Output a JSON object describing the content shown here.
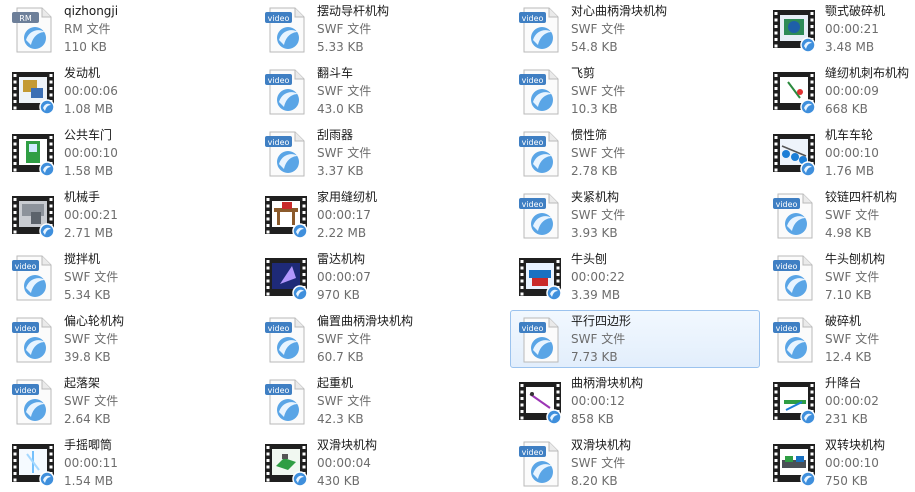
{
  "colors": {
    "selection_border": "#9cc3ee",
    "secondary_text": "#6d6d6d",
    "swf_badge": "#3f7fc3"
  },
  "files": [
    {
      "name": "qizhongji",
      "meta": "RM 文件",
      "size": "110 KB",
      "icon": "rm-file-icon",
      "badge": "RM"
    },
    {
      "name": "摆动导杆机构",
      "meta": "SWF 文件",
      "size": "5.33 KB",
      "icon": "swf-file-icon",
      "badge": "video"
    },
    {
      "name": "对心曲柄滑块机构",
      "meta": "SWF 文件",
      "size": "54.8 KB",
      "icon": "swf-file-icon",
      "badge": "video"
    },
    {
      "name": "颚式破碎机",
      "meta": "00:00:21",
      "size": "3.48 MB",
      "icon": "video-thumbnail-icon"
    },
    {
      "name": "发动机",
      "meta": "00:00:06",
      "size": "1.08 MB",
      "icon": "video-thumbnail-icon"
    },
    {
      "name": "翻斗车",
      "meta": "SWF 文件",
      "size": "43.0 KB",
      "icon": "swf-file-icon",
      "badge": "video"
    },
    {
      "name": "飞剪",
      "meta": "SWF 文件",
      "size": "10.3 KB",
      "icon": "swf-file-icon",
      "badge": "video"
    },
    {
      "name": "缝纫机刺布机构",
      "meta": "00:00:09",
      "size": "668 KB",
      "icon": "video-thumbnail-icon"
    },
    {
      "name": "公共车门",
      "meta": "00:00:10",
      "size": "1.58 MB",
      "icon": "video-thumbnail-icon"
    },
    {
      "name": "刮雨器",
      "meta": "SWF 文件",
      "size": "3.37 KB",
      "icon": "swf-file-icon",
      "badge": "video"
    },
    {
      "name": "惯性筛",
      "meta": "SWF 文件",
      "size": "2.78 KB",
      "icon": "swf-file-icon",
      "badge": "video"
    },
    {
      "name": "机车车轮",
      "meta": "00:00:10",
      "size": "1.76 MB",
      "icon": "video-thumbnail-icon"
    },
    {
      "name": "机械手",
      "meta": "00:00:21",
      "size": "2.71 MB",
      "icon": "video-thumbnail-icon"
    },
    {
      "name": "家用缝纫机",
      "meta": "00:00:17",
      "size": "2.22 MB",
      "icon": "video-thumbnail-icon"
    },
    {
      "name": "夹紧机构",
      "meta": "SWF 文件",
      "size": "3.93 KB",
      "icon": "swf-file-icon",
      "badge": "video"
    },
    {
      "name": "铰链四杆机构",
      "meta": "SWF 文件",
      "size": "4.98 KB",
      "icon": "swf-file-icon",
      "badge": "video"
    },
    {
      "name": "搅拌机",
      "meta": "SWF 文件",
      "size": "5.34 KB",
      "icon": "swf-file-icon",
      "badge": "video"
    },
    {
      "name": "雷达机构",
      "meta": "00:00:07",
      "size": "970 KB",
      "icon": "video-thumbnail-icon"
    },
    {
      "name": "牛头刨",
      "meta": "00:00:22",
      "size": "3.39 MB",
      "icon": "video-thumbnail-icon"
    },
    {
      "name": "牛头刨机构",
      "meta": "SWF 文件",
      "size": "7.10 KB",
      "icon": "swf-file-icon",
      "badge": "video"
    },
    {
      "name": "偏心轮机构",
      "meta": "SWF 文件",
      "size": "39.8 KB",
      "icon": "swf-file-icon",
      "badge": "video"
    },
    {
      "name": "偏置曲柄滑块机构",
      "meta": "SWF 文件",
      "size": "60.7 KB",
      "icon": "swf-file-icon",
      "badge": "video"
    },
    {
      "name": "平行四边形",
      "meta": "SWF 文件",
      "size": "7.73 KB",
      "icon": "swf-file-icon",
      "badge": "video",
      "selected": true
    },
    {
      "name": "破碎机",
      "meta": "SWF 文件",
      "size": "12.4 KB",
      "icon": "swf-file-icon",
      "badge": "video"
    },
    {
      "name": "起落架",
      "meta": "SWF 文件",
      "size": "2.64 KB",
      "icon": "swf-file-icon",
      "badge": "video"
    },
    {
      "name": "起重机",
      "meta": "SWF 文件",
      "size": "42.3 KB",
      "icon": "swf-file-icon",
      "badge": "video"
    },
    {
      "name": "曲柄滑块机构",
      "meta": "00:00:12",
      "size": "858 KB",
      "icon": "video-thumbnail-icon"
    },
    {
      "name": "升降台",
      "meta": "00:00:02",
      "size": "231 KB",
      "icon": "video-thumbnail-icon"
    },
    {
      "name": "手摇唧筒",
      "meta": "00:00:11",
      "size": "1.54 MB",
      "icon": "video-thumbnail-icon"
    },
    {
      "name": "双滑块机构",
      "meta": "00:00:04",
      "size": "430 KB",
      "icon": "video-thumbnail-icon"
    },
    {
      "name": "双滑块机构",
      "meta": "SWF 文件",
      "size": "8.20 KB",
      "icon": "swf-file-icon",
      "badge": "video"
    },
    {
      "name": "双转块机构",
      "meta": "00:00:10",
      "size": "750 KB",
      "icon": "video-thumbnail-icon"
    }
  ]
}
